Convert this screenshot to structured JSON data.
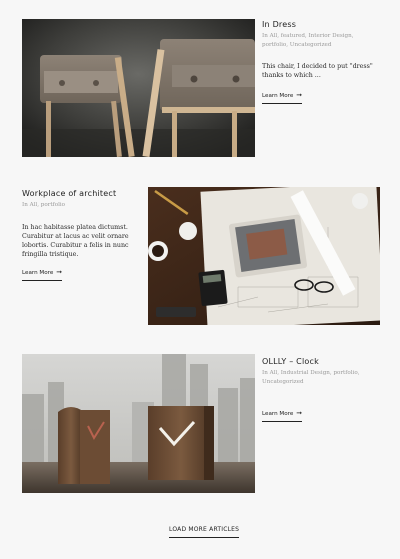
{
  "posts": [
    {
      "title": "In Dress",
      "meta": "In All, featured, Interior Design, portfolio, Uncategorized",
      "excerpt": "This chair, I decided to put \"dress\" thanks to which ...",
      "link_label": "Learn More",
      "image_icon": "chair-photo"
    },
    {
      "title": "Workplace of architect",
      "meta": "In All, portfolio",
      "excerpt": "In hac habitasse platea dictumst. Curabitur at lacus ac velit ornare lobortis. Curabitur a felis in nunc fringilla tristique.",
      "link_label": "Learn More",
      "image_icon": "architect-desk-photo"
    },
    {
      "title": "OLLLY – Clock",
      "meta": "In All, Industrial Design, portfolio, Uncategorized",
      "excerpt": "",
      "link_label": "Learn More",
      "image_icon": "wooden-clock-photo"
    }
  ],
  "load_more_label": "LOAD MORE ARTICLES",
  "colors": {
    "background": "#f7f7f7",
    "text": "#222222",
    "meta": "#9a9a9a"
  }
}
